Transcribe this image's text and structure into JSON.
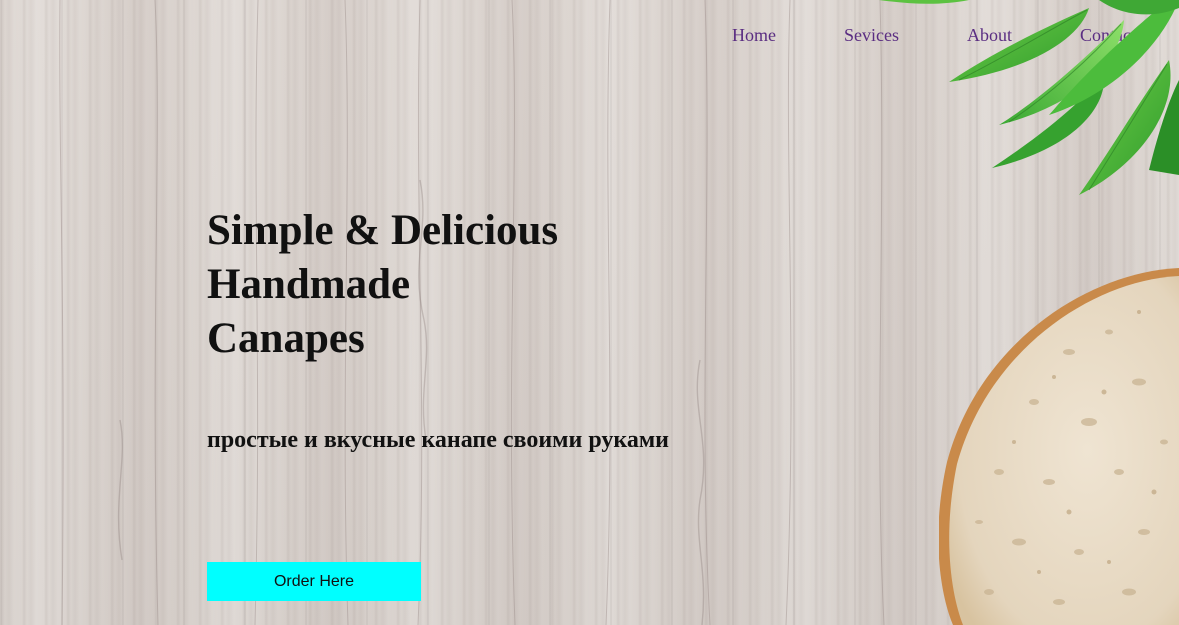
{
  "nav": {
    "items": [
      {
        "label": "Home"
      },
      {
        "label": "Sevices"
      },
      {
        "label": "About"
      },
      {
        "label": "Contact"
      }
    ]
  },
  "hero": {
    "title_line1": "Simple & Delicious",
    "title_line2": "Handmade",
    "title_line3": "Canapes",
    "subtitle": "простые и вкусные канапе своими руками",
    "cta_label": "Order Here"
  },
  "colors": {
    "nav_link": "#5a2d82",
    "cta_background": "#00ffff",
    "heading_text": "#111111"
  },
  "decor": {
    "top_right": "green-leaves-image",
    "bottom_right": "bread-slice-image",
    "background": "light-wood-texture"
  }
}
